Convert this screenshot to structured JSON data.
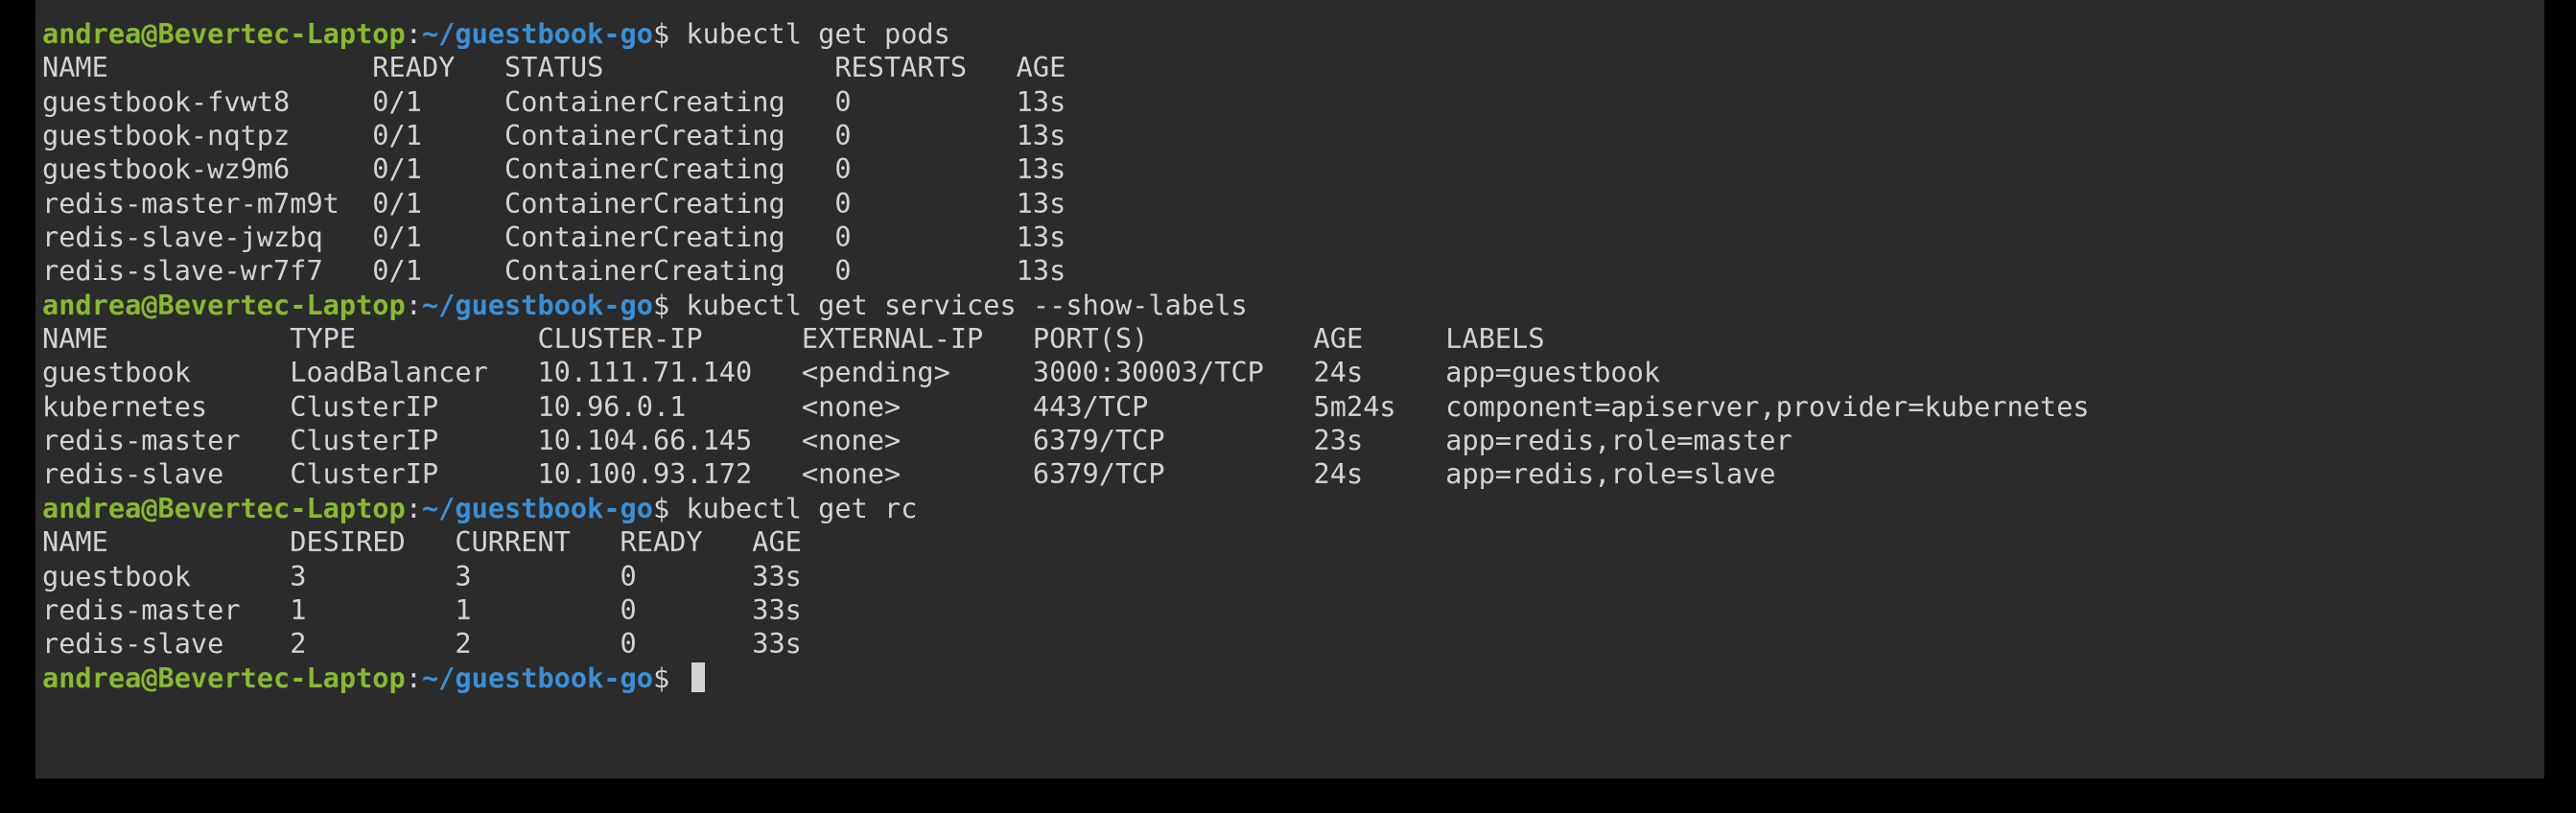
{
  "prompt": {
    "user_host": "andrea@Bevertec-Laptop",
    "separator": ":",
    "path": "~/guestbook-go",
    "symbol": "$ "
  },
  "commands": {
    "get_pods": "kubectl get pods",
    "get_services": "kubectl get services --show-labels",
    "get_rc": "kubectl get rc"
  },
  "pods_table": {
    "header": "NAME                READY   STATUS              RESTARTS   AGE",
    "rows": [
      "guestbook-fvwt8     0/1     ContainerCreating   0          13s",
      "guestbook-nqtpz     0/1     ContainerCreating   0          13s",
      "guestbook-wz9m6     0/1     ContainerCreating   0          13s",
      "redis-master-m7m9t  0/1     ContainerCreating   0          13s",
      "redis-slave-jwzbq   0/1     ContainerCreating   0          13s",
      "redis-slave-wr7f7   0/1     ContainerCreating   0          13s"
    ]
  },
  "services_table": {
    "header": "NAME           TYPE           CLUSTER-IP      EXTERNAL-IP   PORT(S)          AGE     LABELS",
    "rows": [
      "guestbook      LoadBalancer   10.111.71.140   <pending>     3000:30003/TCP   24s     app=guestbook",
      "kubernetes     ClusterIP      10.96.0.1       <none>        443/TCP          5m24s   component=apiserver,provider=kubernetes",
      "redis-master   ClusterIP      10.104.66.145   <none>        6379/TCP         23s     app=redis,role=master",
      "redis-slave    ClusterIP      10.100.93.172   <none>        6379/TCP         24s     app=redis,role=slave"
    ]
  },
  "rc_table": {
    "header": "NAME           DESIRED   CURRENT   READY   AGE",
    "rows": [
      "guestbook      3         3         0       33s",
      "redis-master   1         1         0       33s",
      "redis-slave    2         2         0       33s"
    ]
  },
  "colors": {
    "background": "#2b2b2b",
    "text": "#d3d3d3",
    "user_host": "#8ab92f",
    "path": "#3b8fd6"
  }
}
